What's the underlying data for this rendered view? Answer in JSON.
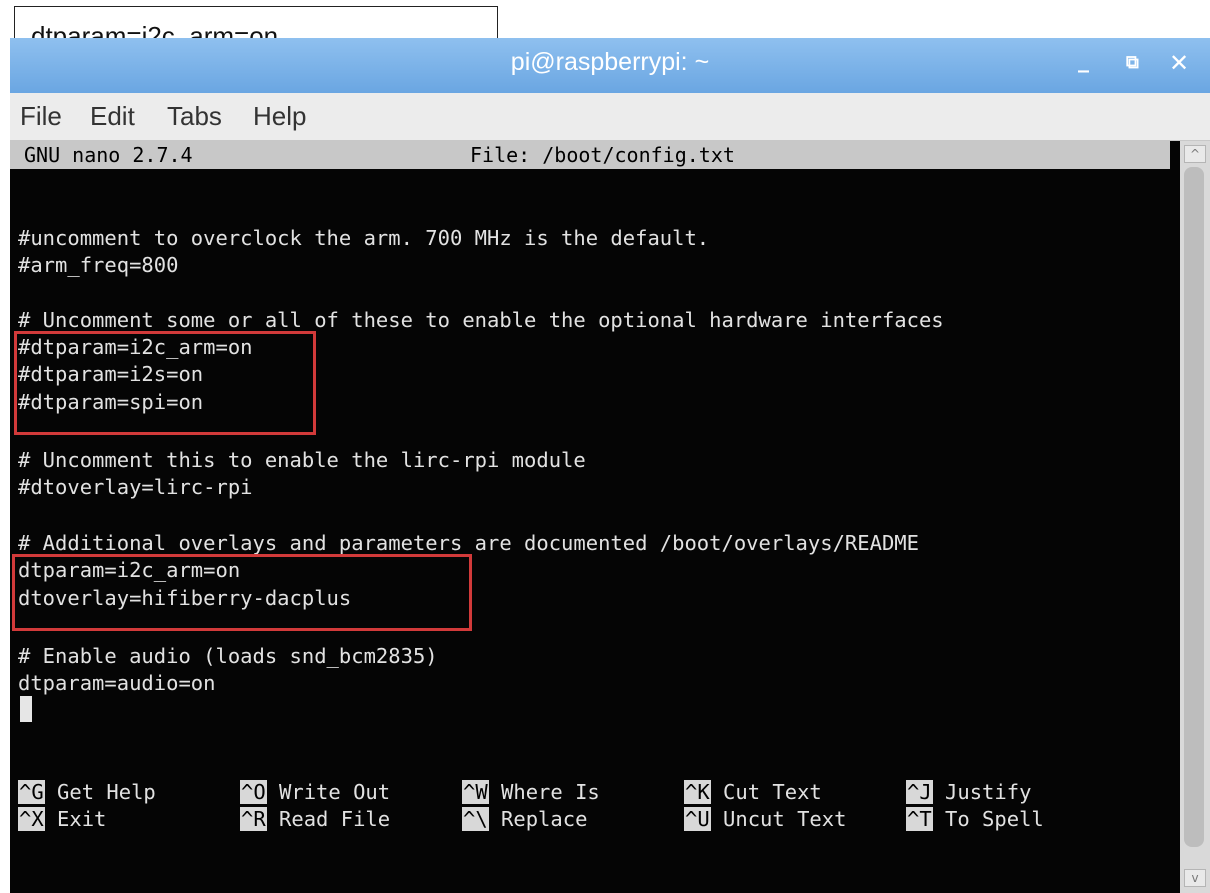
{
  "caption": {
    "text": "dtparam=i2c_arm=on"
  },
  "window": {
    "title": "pi@raspberrypi: ~",
    "controls": {
      "minimize": "_",
      "maximize": "⧉",
      "close": "✕"
    },
    "colors": {
      "titlebar": "#7fb4ea",
      "highlight": "#d23a3a"
    }
  },
  "menu": {
    "items": [
      "File",
      "Edit",
      "Tabs",
      "Help"
    ]
  },
  "nano": {
    "version": "GNU nano 2.7.4",
    "file": "File: /boot/config.txt",
    "lines": [
      "#uncomment to overclock the arm. 700 MHz is the default.",
      "#arm_freq=800",
      "# Uncomment some or all of these to enable the optional hardware interfaces",
      "#dtparam=i2c_arm=on",
      "#dtparam=i2s=on",
      "#dtparam=spi=on",
      "# Uncomment this to enable the lirc-rpi module",
      "#dtoverlay=lirc-rpi",
      "# Additional overlays and parameters are documented /boot/overlays/README",
      "dtparam=i2c_arm=on",
      "dtoverlay=hifiberry-dacplus",
      "# Enable audio (loads snd_bcm2835)",
      "dtparam=audio=on"
    ],
    "shortcuts": [
      {
        "key": "^G",
        "label": "Get Help"
      },
      {
        "key": "^O",
        "label": "Write Out"
      },
      {
        "key": "^W",
        "label": "Where Is"
      },
      {
        "key": "^K",
        "label": "Cut Text"
      },
      {
        "key": "^J",
        "label": "Justify"
      },
      {
        "key": "^X",
        "label": "Exit"
      },
      {
        "key": "^R",
        "label": "Read File"
      },
      {
        "key": "^\\",
        "label": "Replace"
      },
      {
        "key": "^U",
        "label": "Uncut Text"
      },
      {
        "key": "^T",
        "label": "To Spell"
      }
    ]
  }
}
